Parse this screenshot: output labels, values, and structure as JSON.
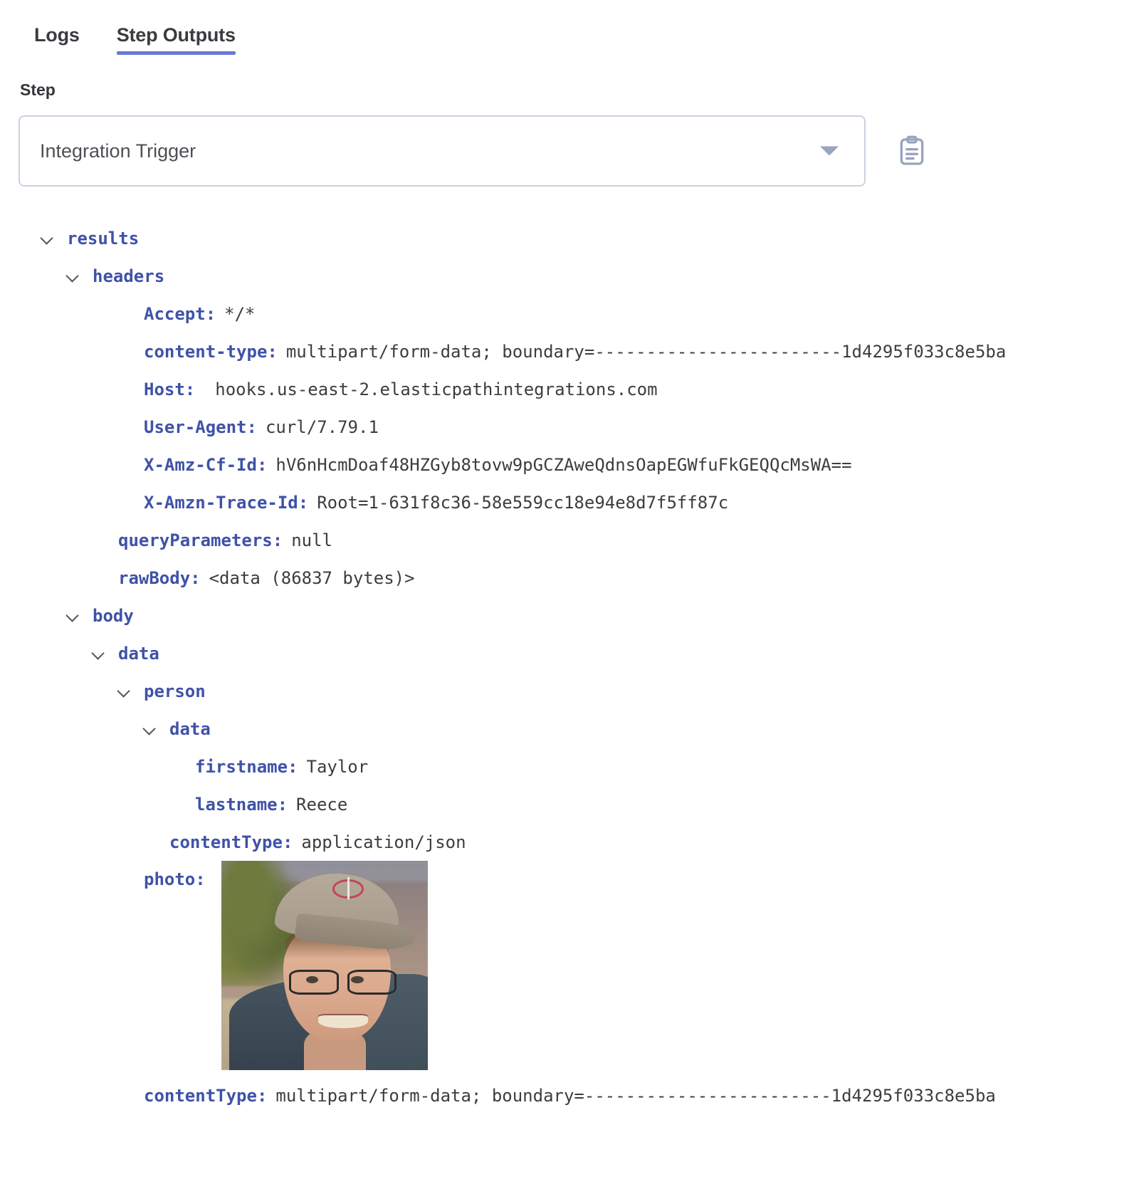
{
  "tabs": [
    {
      "label": "Logs",
      "active": false
    },
    {
      "label": "Step Outputs",
      "active": true
    }
  ],
  "step": {
    "label": "Step",
    "selected": "Integration Trigger",
    "dropdown_icon": "chevron-down-icon",
    "copy_icon": "clipboard-icon"
  },
  "colors": {
    "accent": "#6878d8",
    "json_key": "#3f52a8",
    "json_value": "#3b3d40",
    "border": "#c9d4e0"
  },
  "tree": {
    "results": "results",
    "headers": "headers",
    "accept_key": "Accept:",
    "accept_value": "*/*",
    "content_type_key": "content-type:",
    "content_type_value": "multipart/form-data; boundary=------------------------1d4295f033c8e5ba",
    "host_key": "Host:",
    "host_value": "hooks.us-east-2.elasticpathintegrations.com",
    "user_agent_key": "User-Agent:",
    "user_agent_value": "curl/7.79.1",
    "cf_id_key": "X-Amz-Cf-Id:",
    "cf_id_value": "hV6nHcmDoaf48HZGyb8tovw9pGCZAweQdnsOapEGWfuFkGEQQcMsWA==",
    "trace_id_key": "X-Amzn-Trace-Id:",
    "trace_id_value": "Root=1-631f8c36-58e559cc18e94e8d7f5ff87c",
    "query_params_key": "queryParameters:",
    "query_params_value": "null",
    "raw_body_key": "rawBody:",
    "raw_body_value": "<data (86837 bytes)>",
    "body": "body",
    "data": "data",
    "person": "person",
    "person_data": "data",
    "firstname_key": "firstname:",
    "firstname_value": "Taylor",
    "lastname_key": "lastname:",
    "lastname_value": "Reece",
    "inner_content_type_key": "contentType:",
    "inner_content_type_value": "application/json",
    "photo_key": "photo:",
    "photo_alt": "portrait-photo",
    "outer_content_type_key": "contentType:",
    "outer_content_type_value": "multipart/form-data; boundary=------------------------1d4295f033c8e5ba"
  }
}
